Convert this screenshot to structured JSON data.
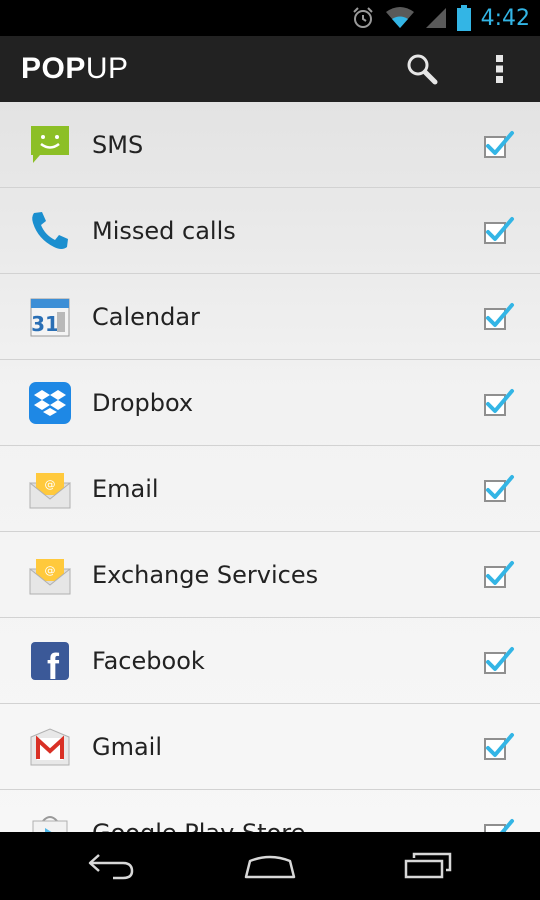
{
  "status_bar": {
    "time": "4:42",
    "icons": [
      "alarm-icon",
      "wifi-icon",
      "signal-icon",
      "battery-icon"
    ]
  },
  "action_bar": {
    "title_bold": "POP",
    "title_light": "UP",
    "actions": [
      "search-icon",
      "overflow-menu-icon"
    ]
  },
  "apps": [
    {
      "label": "SMS",
      "icon": "sms-icon",
      "checked": true
    },
    {
      "label": "Missed calls",
      "icon": "phone-icon",
      "checked": true
    },
    {
      "label": "Calendar",
      "icon": "calendar-icon",
      "icon_text": "31",
      "checked": true
    },
    {
      "label": "Dropbox",
      "icon": "dropbox-icon",
      "checked": true
    },
    {
      "label": "Email",
      "icon": "email-icon",
      "checked": true
    },
    {
      "label": "Exchange Services",
      "icon": "exchange-email-icon",
      "checked": true
    },
    {
      "label": "Facebook",
      "icon": "facebook-icon",
      "icon_text": "f",
      "checked": true
    },
    {
      "label": "Gmail",
      "icon": "gmail-icon",
      "icon_text": "M",
      "checked": true
    },
    {
      "label": "Google Play Store",
      "icon": "play-store-icon",
      "checked": true
    }
  ],
  "nav_bar": {
    "buttons": [
      "back-icon",
      "home-icon",
      "recent-apps-icon"
    ]
  },
  "colors": {
    "accent": "#33b5e5",
    "action_bar": "#222222",
    "list_bg": "#f2f2f2"
  }
}
